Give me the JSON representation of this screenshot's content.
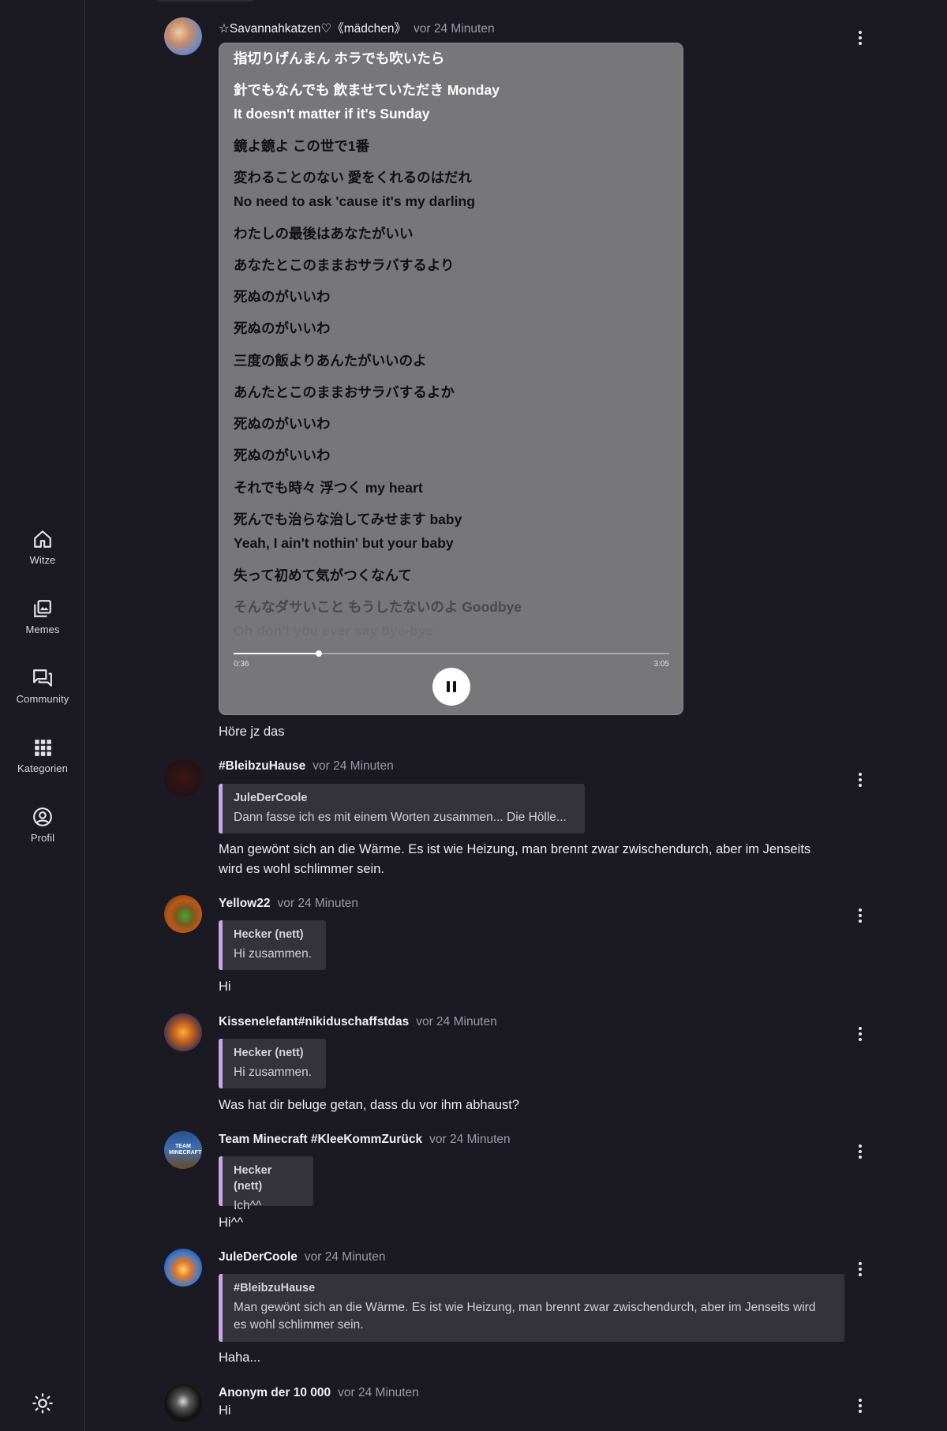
{
  "sidebar": {
    "items": [
      {
        "label": "Witze",
        "icon": "home-icon"
      },
      {
        "label": "Memes",
        "icon": "gallery-icon"
      },
      {
        "label": "Community",
        "icon": "chat-icon"
      },
      {
        "label": "Kategorien",
        "icon": "grid-icon"
      },
      {
        "label": "Profil",
        "icon": "profile-icon"
      }
    ],
    "theme_icon": "sun-icon"
  },
  "posts": [
    {
      "username": "☆Savannahkatzen♡《mädchen》",
      "time": "vor 24 Minuten",
      "lyrics": {
        "lines": [
          "指切りげんまん ホラでも吹いたら",
          "針でもなんでも 飲ませていただき Monday",
          "It doesn't matter if it's Sunday",
          "鏡よ鏡よ この世で1番",
          "変わることのない 愛をくれるのはだれ",
          "No need to ask 'cause it's my darling",
          "わたしの最後はあなたがいい",
          "あなたとこのままおサラバするより",
          "死ぬのがいいわ",
          "死ぬのがいいわ",
          "三度の飯よりあんたがいいのよ",
          "あんたとこのままおサラバするよか",
          "死ぬのがいいわ",
          "死ぬのがいいわ",
          "それでも時々 浮つく my heart",
          "死んでも治らな治してみせます baby",
          "Yeah, I ain't nothin' but your baby",
          "失って初めて気がつくなんて",
          "そんなダサいこと もうしたないのよ Goodbye",
          "Oh don't you ever say bye-bye"
        ],
        "current_time": "0:36",
        "total_time": "3:05",
        "progress": 0.195,
        "control_icon": "pause-icon"
      },
      "text": "Höre jz das"
    },
    {
      "username": "#BleibzuHause",
      "time": "vor 24 Minuten",
      "quote": {
        "user": "JuleDerCoole",
        "text": "Dann fasse ich es mit einem Worten zusammen... Die Hölle..."
      },
      "text_lines": [
        "Man gewönt sich an die Wärme. Es ist wie Heizung, man brennt zwar zwischendurch, aber im Jenseits",
        "wird es wohl schlimmer sein."
      ]
    },
    {
      "username": "Yellow22",
      "time": "vor 24 Minuten",
      "quote": {
        "user": "Hecker (nett)",
        "text": "Hi zusammen."
      },
      "text": "Hi"
    },
    {
      "username": "Kissenelefant#nikiduschaffstdas",
      "time": "vor 24 Minuten",
      "quote": {
        "user": "Hecker (nett)",
        "text": "Hi zusammen."
      },
      "text": "Was hat dir beluge getan, dass du vor ihm abhaust?"
    },
    {
      "username": "Team Minecraft #KleeKommZurück",
      "time": "vor 24 Minuten",
      "avatar_text": "TEAM MINECRAFT",
      "quote": {
        "user": "Hecker (nett)",
        "text": "Ich^^"
      },
      "text": "Hi^^"
    },
    {
      "username": "JuleDerCoole",
      "time": "vor 24 Minuten",
      "quote": {
        "user": "#BleibzuHause",
        "text_lines": [
          "Man gewönt sich an die Wärme. Es ist wie Heizung, man brennt zwar zwischendurch, aber im Jenseits wird",
          "es wohl schlimmer sein."
        ]
      },
      "text": "Haha..."
    },
    {
      "username": "Anonym der 10 000",
      "time": "vor 24 Minuten",
      "text": "Hi"
    }
  ]
}
